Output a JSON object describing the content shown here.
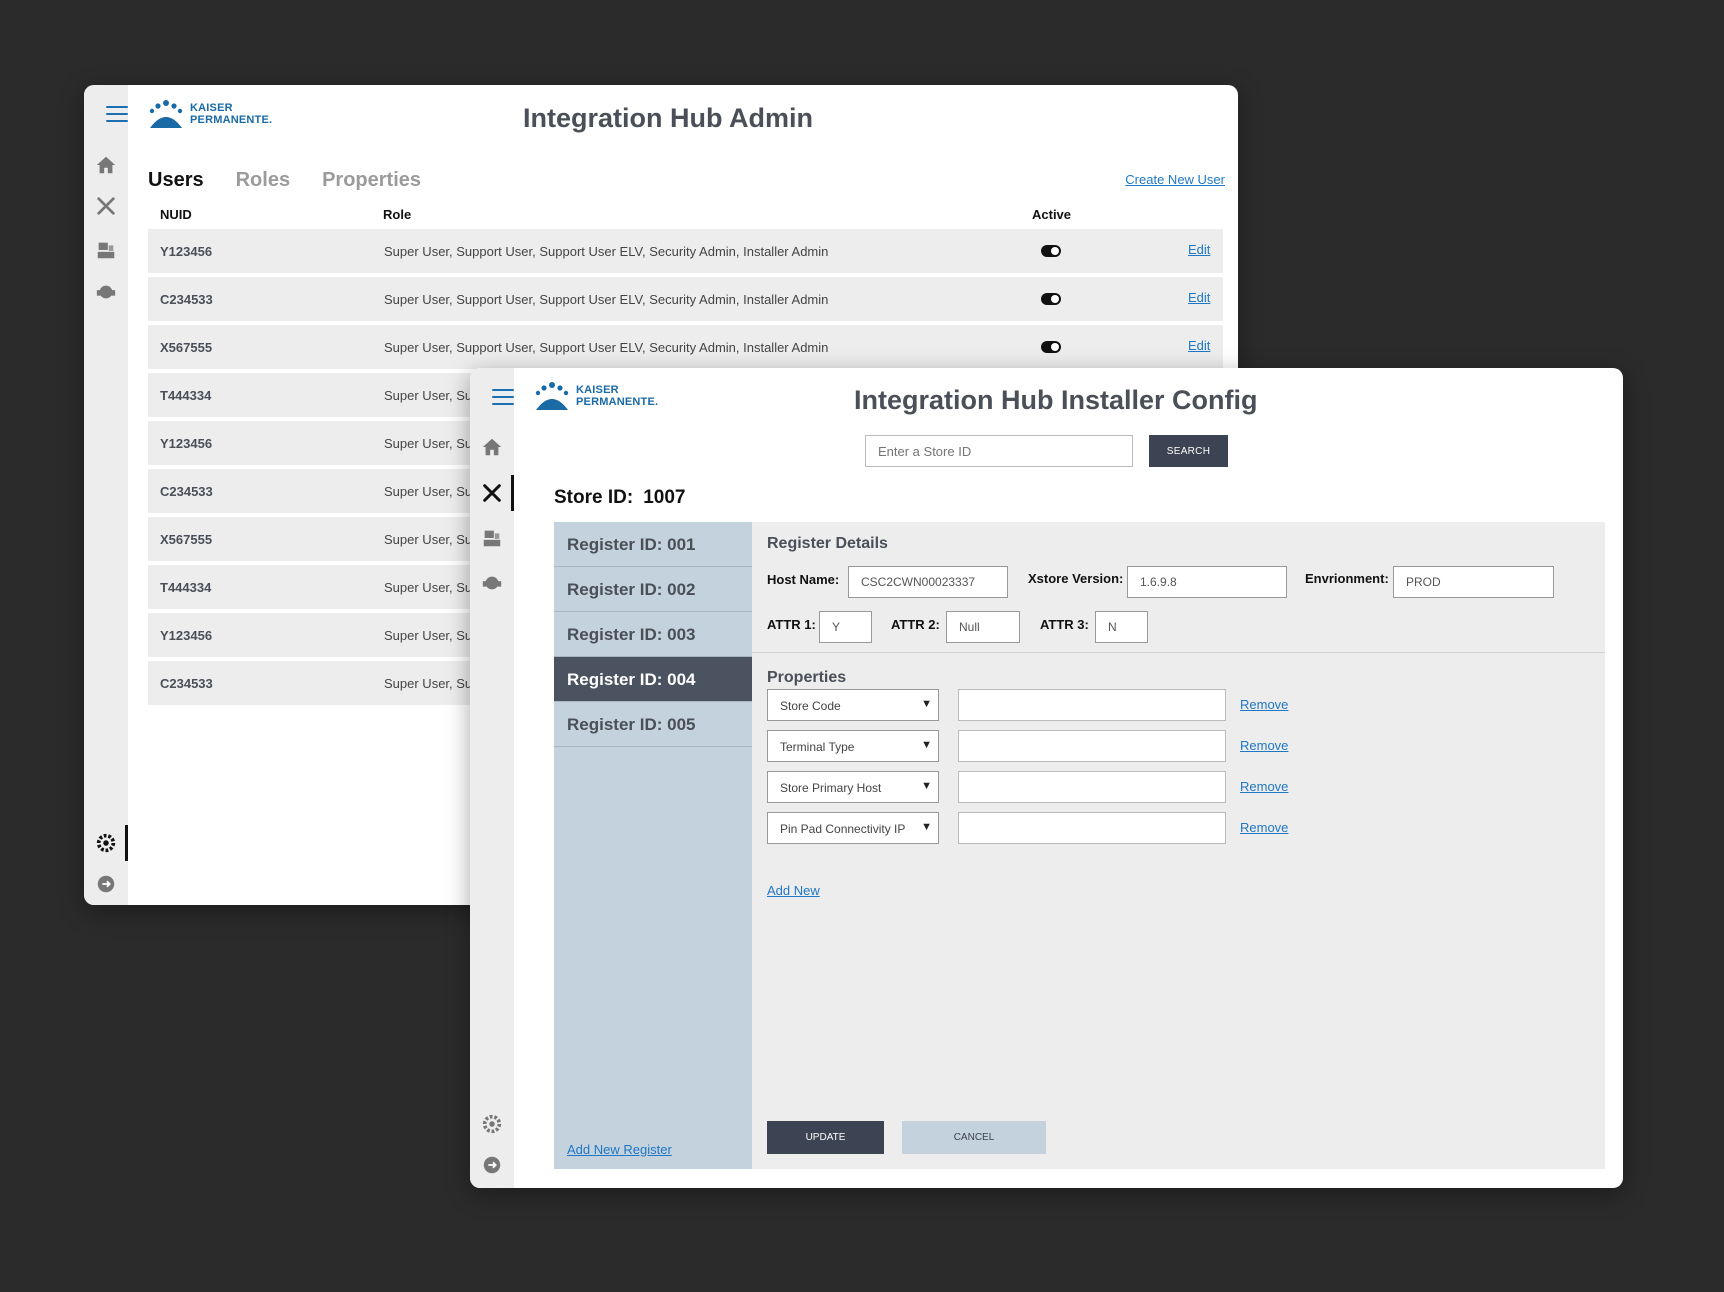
{
  "brand": {
    "line1": "KAISER",
    "line2": "PERMANENTE.",
    "color": "#1a6aa6"
  },
  "admin": {
    "title": "Integration Hub Admin",
    "tabs": [
      "Users",
      "Roles",
      "Properties"
    ],
    "active_tab": "Users",
    "create_link": "Create New User",
    "columns": {
      "nuid": "NUID",
      "role": "Role",
      "active": "Active"
    },
    "edit_label": "Edit",
    "rows": [
      {
        "nuid": "Y123456",
        "role": "Super User, Support User, Support User ELV, Security Admin, Installer Admin",
        "active": true
      },
      {
        "nuid": "C234533",
        "role": "Super User, Support User, Support User ELV, Security Admin, Installer Admin",
        "active": true
      },
      {
        "nuid": "X567555",
        "role": "Super User, Support User, Support User ELV, Security Admin, Installer Admin",
        "active": true
      },
      {
        "nuid": "T444334",
        "role": "Super User, Su"
      },
      {
        "nuid": "Y123456",
        "role": "Super User, Su"
      },
      {
        "nuid": "C234533",
        "role": "Super User, Su"
      },
      {
        "nuid": "X567555",
        "role": "Super User, Su"
      },
      {
        "nuid": "T444334",
        "role": "Super User, Su"
      },
      {
        "nuid": "Y123456",
        "role": "Super User, Su"
      },
      {
        "nuid": "C234533",
        "role": "Super User, Su"
      }
    ]
  },
  "installer": {
    "title": "Integration Hub Installer Config",
    "search": {
      "placeholder": "Enter a Store ID",
      "button": "SEARCH"
    },
    "store": {
      "label": "Store ID:",
      "value": "1007"
    },
    "registers": [
      "Register ID: 001",
      "Register ID: 002",
      "Register ID: 003",
      "Register ID: 004",
      "Register ID: 005"
    ],
    "selected_register": "Register ID: 004",
    "add_register": "Add New Register",
    "details": {
      "title": "Register Details",
      "host_label": "Host Name:",
      "host_value": "CSC2CWN00023337",
      "xstore_label": "Xstore Version:",
      "xstore_value": "1.6.9.8",
      "env_label": "Envrionment:",
      "env_value": "PROD",
      "attr1_label": "ATTR 1:",
      "attr1_value": "Y",
      "attr2_label": "ATTR 2:",
      "attr2_value": "Null",
      "attr3_label": "ATTR 3:",
      "attr3_value": "N"
    },
    "properties": {
      "title": "Properties",
      "items": [
        {
          "name": "Store Code",
          "value": ""
        },
        {
          "name": "Terminal Type",
          "value": ""
        },
        {
          "name": "Store Primary Host",
          "value": ""
        },
        {
          "name": "Pin Pad Connectivity IP",
          "value": ""
        }
      ],
      "remove_label": "Remove",
      "add_label": "Add New"
    },
    "buttons": {
      "update": "UPDATE",
      "cancel": "CANCEL"
    }
  },
  "colors": {
    "dark_button": "#3c4352",
    "register_panel": "#c4d2dd",
    "link": "#1f77c6"
  }
}
